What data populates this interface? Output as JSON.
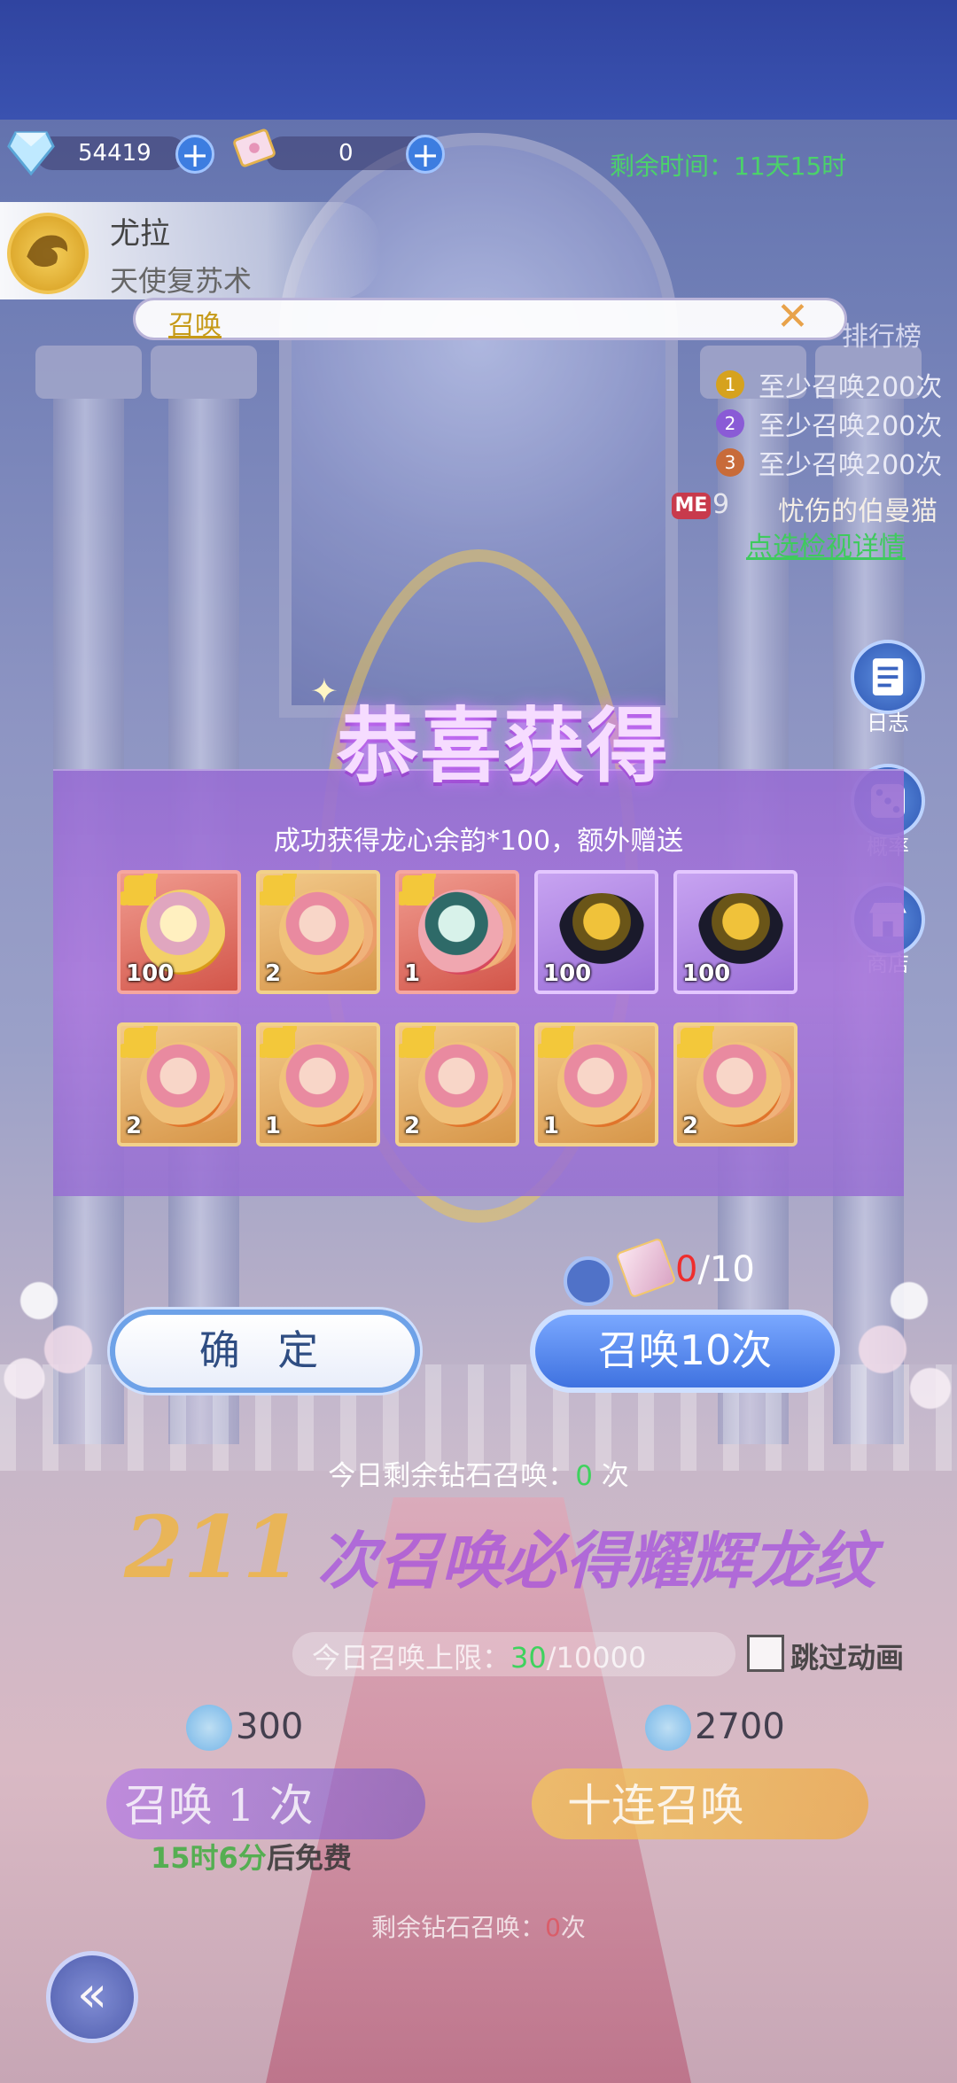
{
  "currency": {
    "diamond_amount": "54419",
    "ticket_amount": "0",
    "plus_label": "+"
  },
  "timer": {
    "label": "剩余时间：",
    "value": "11天15时"
  },
  "character": {
    "name": "尤拉",
    "subtitle": "天使复苏术"
  },
  "notice": {
    "label": "召唤",
    "close": "✕"
  },
  "ranking": {
    "title": "排行榜",
    "rows": [
      {
        "medal": "1",
        "text": "至少召唤200次",
        "color": "#d6a21e"
      },
      {
        "medal": "2",
        "text": "至少召唤200次",
        "color": "#8a5bd6"
      },
      {
        "medal": "3",
        "text": "至少召唤200次",
        "color": "#c86b3a"
      }
    ],
    "me_badge": "ME",
    "me_rank": "9",
    "me_name": "忧伤的伯曼猫",
    "detail_link": "点选检视详情"
  },
  "side_menu": [
    {
      "label": "日志",
      "icon": "log-icon"
    },
    {
      "label": "概率",
      "icon": "dice-icon"
    },
    {
      "label": "商店",
      "icon": "shop-icon"
    }
  ],
  "reward": {
    "title": "恭喜获得",
    "message": "成功获得龙心余韵*100，额外赠送",
    "items_row1": [
      {
        "qty": "100",
        "style": "red",
        "art": "gold-coin"
      },
      {
        "qty": "2",
        "style": "gold",
        "art": "fragment"
      },
      {
        "qty": "1",
        "style": "red",
        "art": "aqua"
      },
      {
        "qty": "100",
        "style": "purple",
        "art": "egg"
      },
      {
        "qty": "100",
        "style": "purple",
        "art": "egg"
      }
    ],
    "items_row2": [
      {
        "qty": "2",
        "style": "gold",
        "art": "fragment"
      },
      {
        "qty": "1",
        "style": "gold",
        "art": "fragment"
      },
      {
        "qty": "2",
        "style": "gold",
        "art": "fragment"
      },
      {
        "qty": "1",
        "style": "gold",
        "art": "fragment"
      },
      {
        "qty": "2",
        "style": "gold",
        "art": "fragment"
      }
    ]
  },
  "actions": {
    "confirm_label": "确 定",
    "summon_label": "召唤10次",
    "counter_current": "0",
    "counter_total": "/10"
  },
  "background": {
    "today_diamond_prefix": "今日剩余钻石召唤：",
    "today_diamond_value": "0",
    "today_diamond_suffix": " 次",
    "banner_number": "211",
    "banner_text": "次召唤必得耀辉龙纹",
    "limit_prefix": "今日召唤上限：",
    "limit_current": "30",
    "limit_total": "/10000",
    "skip_label": "跳过动画",
    "single_cost": "300",
    "ten_cost": "2700",
    "single_label": "召唤 1 次",
    "ten_label": "十连召唤",
    "free_time": "15时6分",
    "free_suffix": "后免费",
    "remain_prefix": "剩余钻石召唤：",
    "remain_value": "0",
    "remain_suffix": "次",
    "back_arrow": "«"
  }
}
